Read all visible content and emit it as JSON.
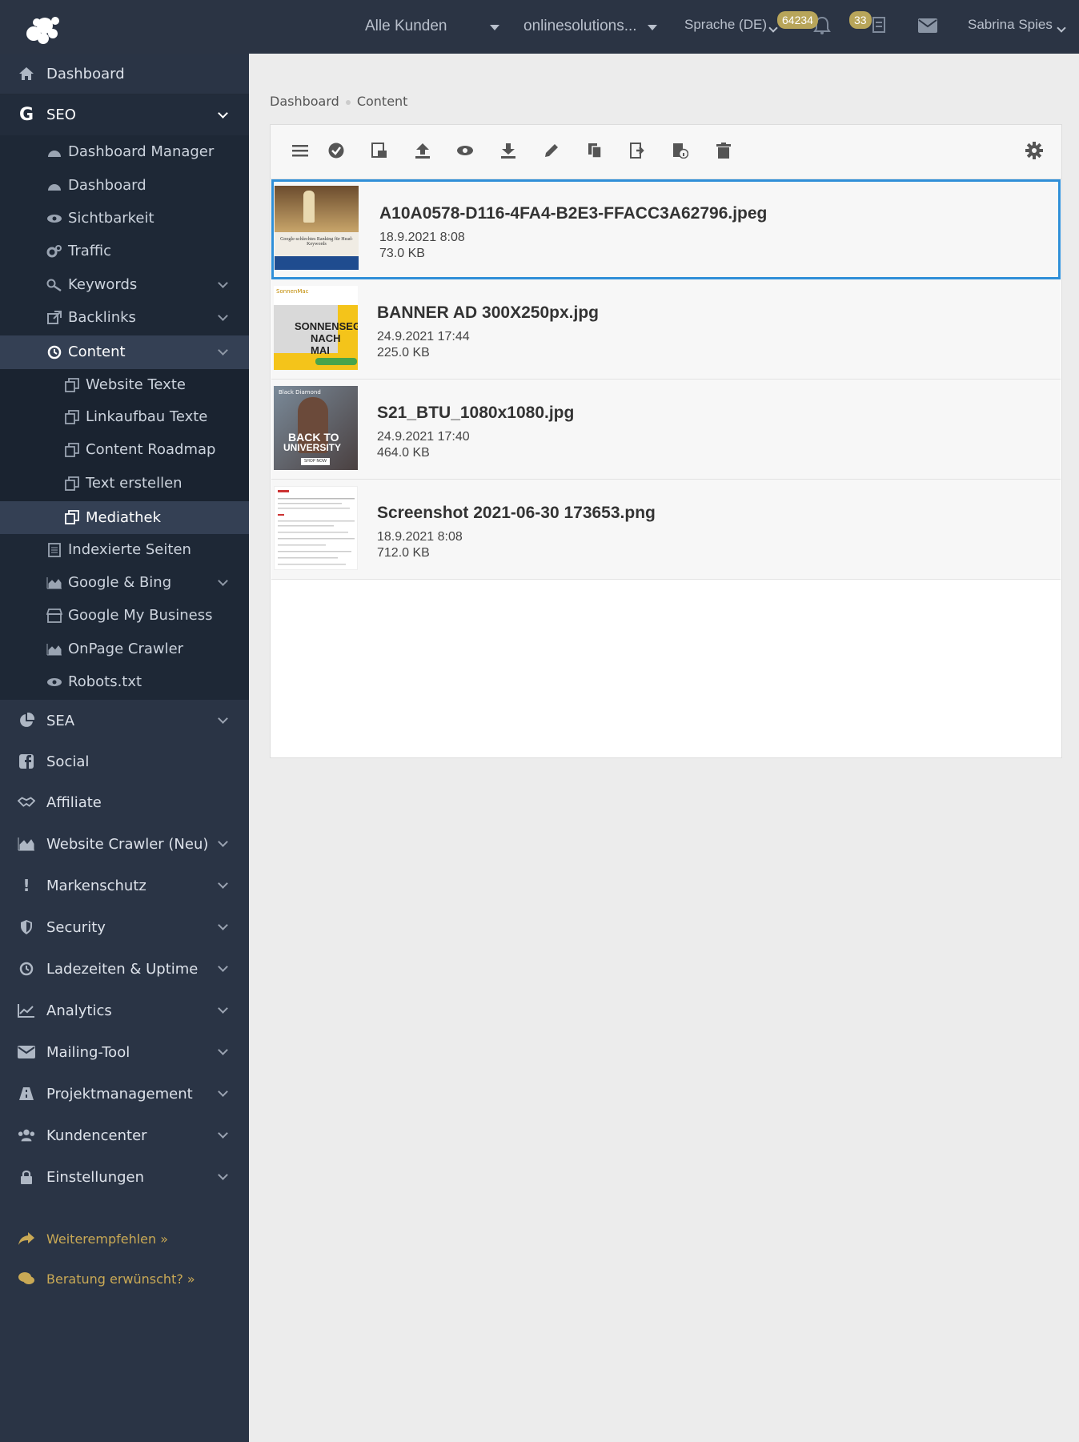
{
  "topbar": {
    "customers_select": "Alle Kunden",
    "project_select": "onlinesolutions...",
    "language": "Sprache (DE)",
    "notifications_count": "64234",
    "tasks_count": "33",
    "user_name": "Sabrina Spies"
  },
  "sidebar": {
    "dashboard": "Dashboard",
    "seo": "SEO",
    "seo_items": {
      "dashboard_manager": "Dashboard Manager",
      "dashboard": "Dashboard",
      "sichtbarkeit": "Sichtbarkeit",
      "traffic": "Traffic",
      "keywords": "Keywords",
      "backlinks": "Backlinks",
      "content": "Content",
      "content_items": {
        "website_texte": "Website Texte",
        "linkaufbau_texte": "Linkaufbau Texte",
        "content_roadmap": "Content Roadmap",
        "text_erstellen": "Text erstellen",
        "mediathek": "Mediathek"
      },
      "indexierte_seiten": "Indexierte Seiten",
      "google_bing": "Google & Bing",
      "google_my_business": "Google My Business",
      "onpage_crawler": "OnPage Crawler",
      "robots": "Robots.txt"
    },
    "sea": "SEA",
    "social": "Social",
    "affiliate": "Affiliate",
    "website_crawler": "Website Crawler (Neu)",
    "markenschutz": "Markenschutz",
    "security": "Security",
    "ladezeiten": "Ladezeiten & Uptime",
    "analytics": "Analytics",
    "mailing_tool": "Mailing-Tool",
    "projektmanagement": "Projektmanagement",
    "kundencenter": "Kundencenter",
    "einstellungen": "Einstellungen",
    "weiterempfehlen": "Weiterempfehlen »",
    "beratung": "Beratung erwünscht? »"
  },
  "breadcrumb": {
    "home": "Dashboard",
    "current": "Content"
  },
  "files": [
    {
      "name": "A10A0578-D116-4FA4-B2E3-FFACC3A62796.jpeg",
      "date": "18.9.2021 8:08",
      "size": "73.0 KB"
    },
    {
      "name": "BANNER AD 300X250px.jpg",
      "date": "24.9.2021 17:44",
      "size": "225.0 KB"
    },
    {
      "name": "S21_BTU_1080x1080.jpg",
      "date": "24.9.2021 17:40",
      "size": "464.0 KB"
    },
    {
      "name": "Screenshot 2021-06-30 173653.png",
      "date": "18.9.2021 8:08",
      "size": "712.0 KB"
    }
  ],
  "thumbs": {
    "t1_text": "Google-schlechtes Ranking für Head-Keywords",
    "t2_brand": "SonnenMac",
    "t2_line1": "SONNENSEGE",
    "t2_line2": "NACH MAI",
    "t3_brand": "Black Diamond",
    "t3_line1": "BACK TO",
    "t3_line2": "UNIVERSITY",
    "t3_cta": "SHOP NOW"
  },
  "colors": {
    "sidebar": "#2a3445",
    "accent": "#2f8fd8",
    "badge": "#b8a55a",
    "gold_link": "#c9a955"
  }
}
